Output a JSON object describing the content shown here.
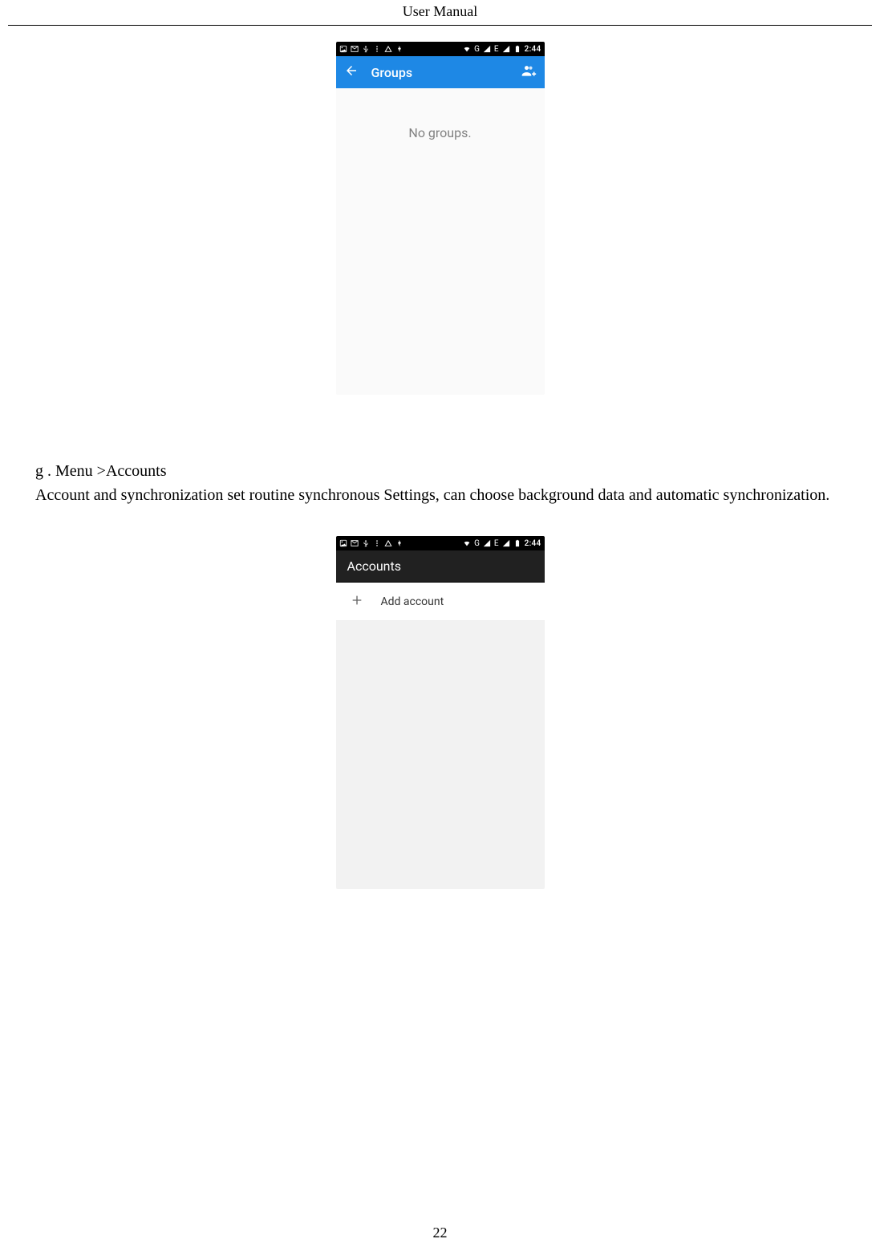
{
  "header": {
    "title": "User  Manual"
  },
  "page_number": "22",
  "screenshot1": {
    "status": {
      "time": "2:44",
      "net": "G",
      "net2": "E"
    },
    "appbar": {
      "title": "Groups"
    },
    "body": {
      "empty": "No groups."
    }
  },
  "doc": {
    "heading": "g . Menu >Accounts",
    "body": "Account and synchronization set routine synchronous Settings, can choose background data and automatic synchronization."
  },
  "screenshot2": {
    "status": {
      "time": "2:44",
      "net": "G",
      "net2": "E"
    },
    "appbar": {
      "title": "Accounts"
    },
    "row": {
      "label": "Add account"
    }
  }
}
